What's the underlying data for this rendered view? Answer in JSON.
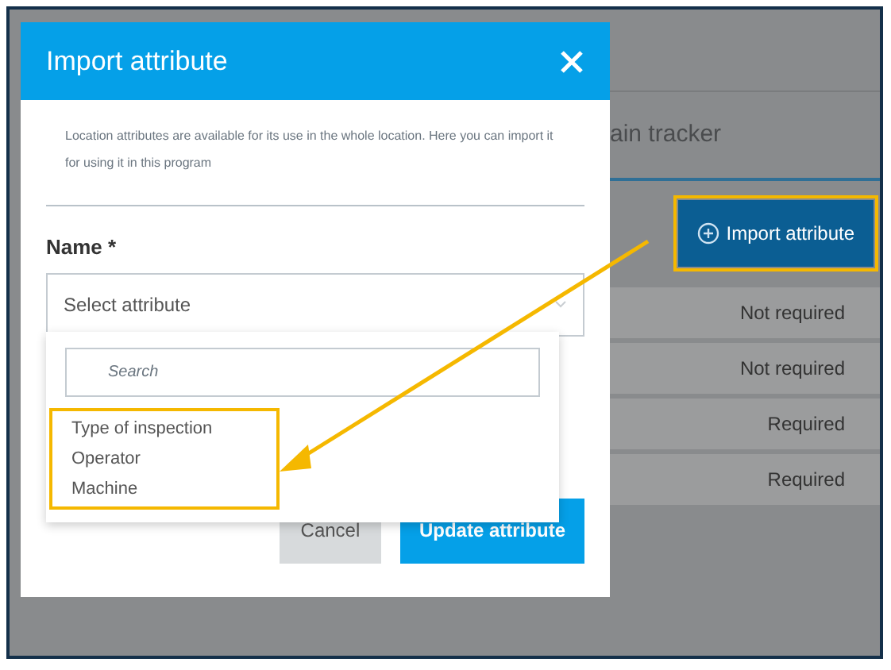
{
  "background": {
    "tab_label": "ain tracker",
    "import_button": {
      "label": "Import attribute",
      "highlighted": true
    },
    "rows": [
      {
        "requirement": "Not required"
      },
      {
        "requirement": "Not required"
      },
      {
        "requirement": "Required"
      },
      {
        "requirement": "Required"
      }
    ]
  },
  "dialog": {
    "title": "Import attribute",
    "description": "Location attributes are available for its use in the whole location. Here you can import it for using it in this program",
    "field_label": "Name *",
    "select": {
      "placeholder": "Select attribute"
    },
    "dropdown": {
      "search_placeholder": "Search",
      "options_highlighted": true,
      "options": [
        "Type of inspection",
        "Operator",
        "Machine"
      ]
    },
    "buttons": [
      {
        "label": "Cancel",
        "kind": "secondary"
      },
      {
        "label": "Update attribute",
        "kind": "primary"
      }
    ]
  }
}
